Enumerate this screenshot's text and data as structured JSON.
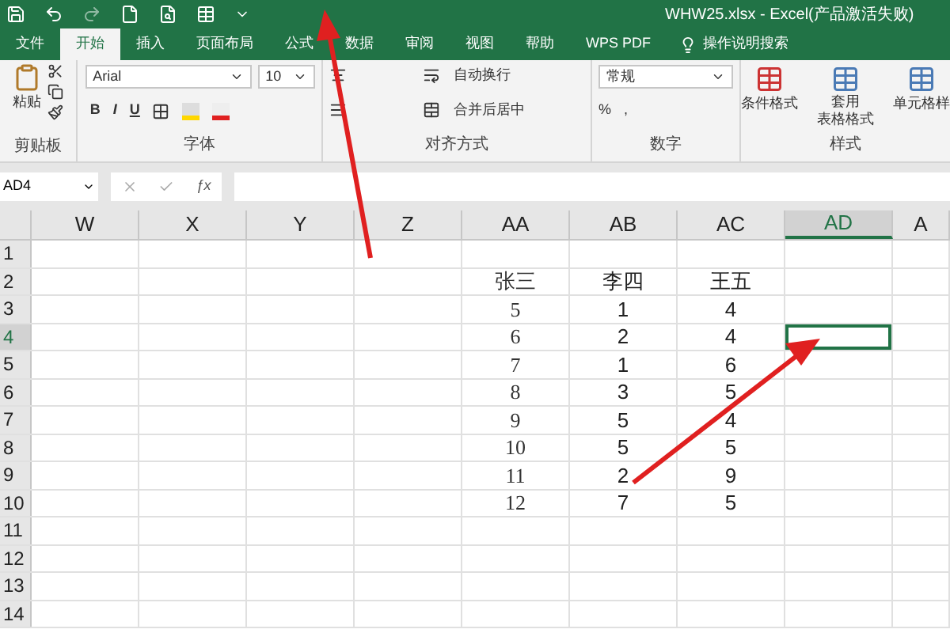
{
  "window": {
    "title": "WHW25.xlsx  -  Excel(产品激活失败)"
  },
  "tabs": [
    {
      "label": "文件",
      "selected": false
    },
    {
      "label": "开始",
      "selected": true
    },
    {
      "label": "插入",
      "selected": false
    },
    {
      "label": "页面布局",
      "selected": false
    },
    {
      "label": "公式",
      "selected": false
    },
    {
      "label": "数据",
      "selected": false
    },
    {
      "label": "审阅",
      "selected": false
    },
    {
      "label": "视图",
      "selected": false
    },
    {
      "label": "帮助",
      "selected": false
    },
    {
      "label": "WPS PDF",
      "selected": false
    }
  ],
  "tell_me": {
    "placeholder": "操作说明搜索"
  },
  "ribbon": {
    "clipboard": {
      "paste": "粘贴",
      "label": "剪贴板"
    },
    "font": {
      "font_name": "Arial",
      "font_size": "10",
      "bold": "B",
      "italic": "I",
      "underline": "U",
      "label": "字体"
    },
    "alignment": {
      "wrap_text": "自动换行",
      "merge_center": "合并后居中",
      "label": "对齐方式"
    },
    "number": {
      "format": "常规",
      "percent": "%",
      "comma": ",",
      "label": "数字"
    },
    "styles": {
      "conditional": "条件格式",
      "table_format": [
        "套用",
        "表格格式"
      ],
      "cell_styles": "单元格样",
      "label": "样式"
    }
  },
  "name_box": {
    "value": "AD4"
  },
  "formula_bar": {
    "function_icon": "ƒx"
  },
  "columns": [
    {
      "label": "W",
      "selected": false
    },
    {
      "label": "X",
      "selected": false
    },
    {
      "label": "Y",
      "selected": false
    },
    {
      "label": "Z",
      "selected": false
    },
    {
      "label": "AA",
      "selected": false
    },
    {
      "label": "AB",
      "selected": false
    },
    {
      "label": "AC",
      "selected": false
    },
    {
      "label": "AD",
      "selected": true
    },
    {
      "label": "A",
      "selected": false
    }
  ],
  "rows": [
    {
      "label": "1",
      "selected": false
    },
    {
      "label": "2",
      "selected": false,
      "aa": "张三",
      "ab": "李四",
      "ac": "王五"
    },
    {
      "label": "3",
      "selected": false,
      "aa": "5",
      "ab": "1",
      "ac": "4"
    },
    {
      "label": "4",
      "selected": true,
      "aa": "6",
      "ab": "2",
      "ac": "4"
    },
    {
      "label": "5",
      "selected": false,
      "aa": "7",
      "ab": "1",
      "ac": "6"
    },
    {
      "label": "6",
      "selected": false,
      "aa": "8",
      "ab": "3",
      "ac": "5"
    },
    {
      "label": "7",
      "selected": false,
      "aa": "9",
      "ab": "5",
      "ac": "4"
    },
    {
      "label": "8",
      "selected": false,
      "aa": "10",
      "ab": "5",
      "ac": "5"
    },
    {
      "label": "9",
      "selected": false,
      "aa": "11",
      "ab": "2",
      "ac": "9"
    },
    {
      "label": "10",
      "selected": false,
      "aa": "12",
      "ab": "7",
      "ac": "5"
    },
    {
      "label": "11",
      "selected": false
    },
    {
      "label": "12",
      "selected": false
    },
    {
      "label": "13",
      "selected": false
    },
    {
      "label": "14",
      "selected": false
    }
  ]
}
